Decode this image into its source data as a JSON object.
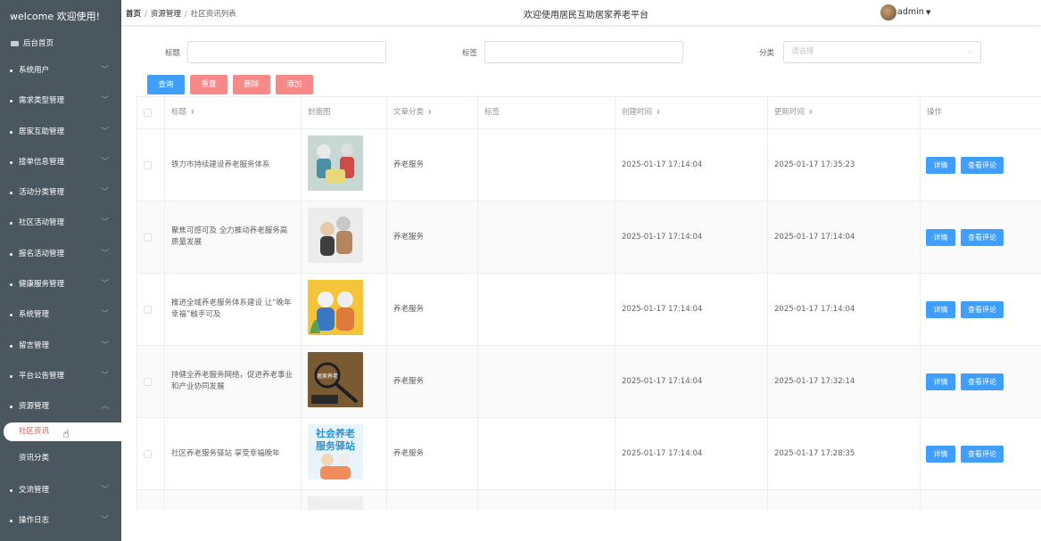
{
  "sidebar": {
    "welcome": "welcome 欢迎使用!",
    "home": "后台首页",
    "items": [
      {
        "label": "系统用户"
      },
      {
        "label": "需求类型管理"
      },
      {
        "label": "居家互助管理"
      },
      {
        "label": "接单信息管理"
      },
      {
        "label": "活动分类管理"
      },
      {
        "label": "社区活动管理"
      },
      {
        "label": "报名活动管理"
      },
      {
        "label": "健康服务管理"
      },
      {
        "label": "系统管理"
      },
      {
        "label": "留言管理"
      },
      {
        "label": "平台公告管理"
      },
      {
        "label": "资源管理"
      }
    ],
    "sub_items": [
      {
        "label": "社区资讯"
      },
      {
        "label": "资讯分类"
      }
    ],
    "after_items": [
      {
        "label": "交流管理"
      },
      {
        "label": "操作日志"
      }
    ]
  },
  "topbar": {
    "breadcrumb": [
      "首页",
      "资源管理",
      "社区资讯列表"
    ],
    "title": "欢迎使用居民互助居家养老平台",
    "user": "admin"
  },
  "search": {
    "title_label": "标题",
    "tag_label": "标签",
    "category_label": "分类",
    "category_placeholder": "请选择"
  },
  "buttons": {
    "query": "查询",
    "reset": "重置",
    "delete": "删除",
    "add": "添加"
  },
  "colors": {
    "primary": "#409eff",
    "danger": "#f78989",
    "sidebar": "#4b575f"
  },
  "table": {
    "headers": [
      "标题",
      "封面图",
      "文章分类",
      "标签",
      "创建时间",
      "更新时间",
      "操作"
    ],
    "rows": [
      {
        "title": "铁力市持续建设养老服务体系",
        "category": "养老服务",
        "tag": "",
        "created": "2025-01-17 17:14:04",
        "updated": "2025-01-17 17:35:23"
      },
      {
        "title": "聚焦可感可及 全力推动养老服务高质量发展",
        "category": "养老服务",
        "tag": "",
        "created": "2025-01-17 17:14:04",
        "updated": "2025-01-17 17:14:04"
      },
      {
        "title": "推进全域养老服务体系建设 让“晚年幸福”触手可及",
        "category": "养老服务",
        "tag": "",
        "created": "2025-01-17 17:14:04",
        "updated": "2025-01-17 17:14:04"
      },
      {
        "title": "持健全养老服务网络，促进养老事业和产业协同发展",
        "category": "养老服务",
        "tag": "",
        "created": "2025-01-17 17:14:04",
        "updated": "2025-01-17 17:32:14"
      },
      {
        "title": "社区养老服务驿站 享受幸福晚年",
        "category": "养老服务",
        "tag": "",
        "created": "2025-01-17 17:14:04",
        "updated": "2025-01-17 17:28:35"
      }
    ],
    "action_detail": "详情",
    "action_comments": "查看评论"
  },
  "thumbnails": {
    "row4_text": "居家养老",
    "row5_line1": "社会养老",
    "row5_line2": "服务驿站"
  }
}
